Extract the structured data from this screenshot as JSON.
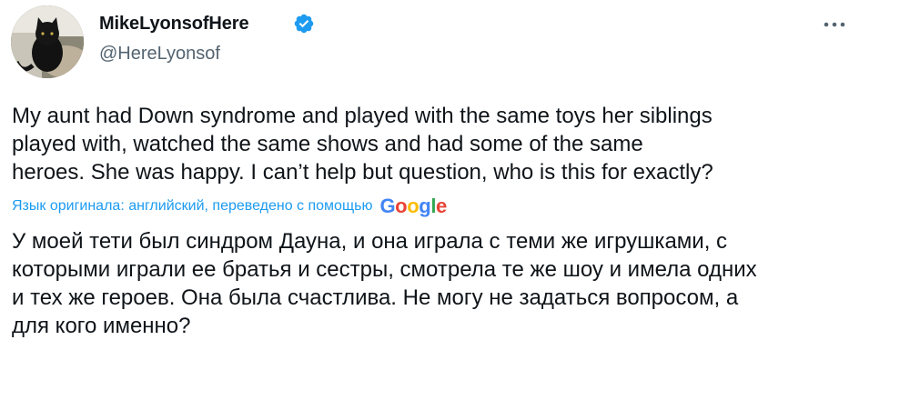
{
  "author": {
    "display_name": "MikeLyonsofHere",
    "handle": "@HereLyonsof",
    "verified": true,
    "avatar_icon": "black-cat-photo"
  },
  "menu_icon": "more-horizontal-icon",
  "tweet": {
    "original_text": "My aunt had Down syndrome and played with the same toys her siblings\nplayed with, watched the same shows and had some of the same\nheroes. She was happy. I can’t help but question, who is this for exactly?",
    "translation_note": "Язык оригинала: английский, переведено с помощью",
    "translation_provider": {
      "letters": [
        "G",
        "o",
        "o",
        "g",
        "l",
        "e"
      ],
      "colors": [
        "#4285f4",
        "#ea4335",
        "#fbbc05",
        "#4285f4",
        "#34a853",
        "#ea4335"
      ]
    },
    "translated_text": "У моей тети был синдром Дауна, и она играла с теми же игрушками, с\nкоторыми играли ее братья и сестры, смотрела те же шоу и имела одних\nи тех же героев. Она была счастлива. Не могу не задаться вопросом, а\nдля кого именно?"
  },
  "colors": {
    "text": "#0f1419",
    "secondary_text": "#536471",
    "link_blue": "#1d9bf0",
    "verified_blue": "#1d9bf0"
  }
}
